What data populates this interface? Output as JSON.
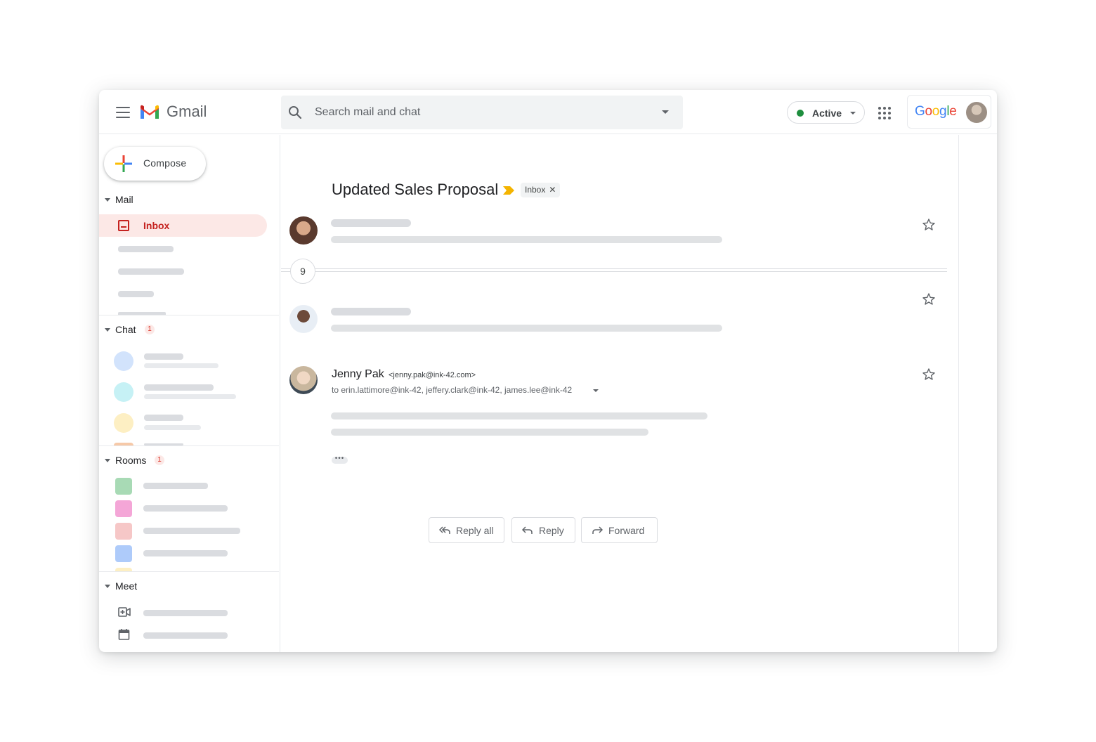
{
  "app": {
    "name": "Gmail"
  },
  "search": {
    "placeholder": "Search mail and chat"
  },
  "status": {
    "label": "Active",
    "color": "#1e8e3e"
  },
  "account": {
    "brand_letters": [
      "G",
      "o",
      "o",
      "g",
      "l",
      "e"
    ]
  },
  "compose": {
    "label": "Compose"
  },
  "sidebar": {
    "mail": {
      "label": "Mail",
      "inbox_label": "Inbox"
    },
    "chat": {
      "label": "Chat",
      "badge": "1"
    },
    "rooms": {
      "label": "Rooms",
      "badge": "1"
    },
    "meet": {
      "label": "Meet"
    }
  },
  "thread": {
    "subject": "Updated Sales Proposal",
    "label_chip": "Inbox",
    "collapsed_count": "9",
    "open_message": {
      "sender_name": "Jenny Pak",
      "sender_email": "<jenny.pak@ink-42.com>",
      "recipients": "to erin.lattimore@ink-42, jeffery.clark@ink-42, james.lee@ink-42"
    }
  },
  "actions": {
    "reply_all": "Reply all",
    "reply": "Reply",
    "forward": "Forward"
  },
  "colors": {
    "accent_red": "#c5221f",
    "inbox_highlight": "#fce8e6",
    "importance": "#f4b400",
    "chat_avatars": [
      "#d2e3fc",
      "#c6f1f5",
      "#fdefc3"
    ],
    "room_tiles": [
      "#a8dab5",
      "#f4a6d7",
      "#f6c7c7",
      "#aecbfa"
    ]
  },
  "icons": [
    "menu-icon",
    "gmail-logo-icon",
    "search-icon",
    "chevron-down-icon",
    "apps-grid-icon",
    "plus-icon",
    "inbox-icon",
    "star-icon",
    "importance-icon",
    "close-icon",
    "reply-all-icon",
    "reply-icon",
    "forward-icon",
    "video-add-icon",
    "calendar-icon"
  ]
}
